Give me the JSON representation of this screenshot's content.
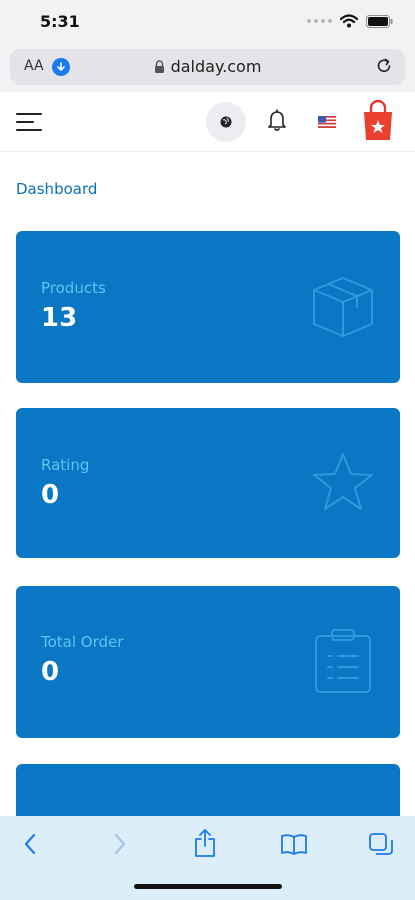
{
  "status_bar": {
    "time": "5:31"
  },
  "browser": {
    "text_size_label": "AA",
    "url": "dalday.com"
  },
  "header": {
    "icons": [
      "menu-icon",
      "globe-icon",
      "bell-icon",
      "us-flag-icon",
      "shopping-bag-icon"
    ]
  },
  "breadcrumb": {
    "label": "Dashboard"
  },
  "cards": [
    {
      "label": "Products",
      "value": "13",
      "icon": "box-icon"
    },
    {
      "label": "Rating",
      "value": "0",
      "icon": "star-icon"
    },
    {
      "label": "Total Order",
      "value": "0",
      "icon": "clipboard-icon"
    },
    {
      "label": "",
      "value": "",
      "icon": ""
    }
  ],
  "colors": {
    "card_bg": "#0a77c4",
    "card_label": "#5fc3f3",
    "link_blue": "#0a6fb8",
    "toolbar_bg": "#dceefa"
  }
}
